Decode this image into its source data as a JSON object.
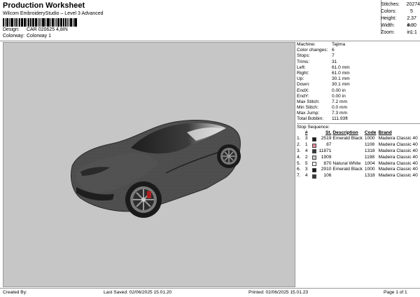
{
  "header": {
    "title": "Production Worksheet",
    "subtitle": "Wilcom EmbroideryStudio – Level 3 Advanced",
    "design_label": "Design:",
    "design_value": "CAR 020625 4,8IN",
    "colorway_label": "Colorway:",
    "colorway_value": "Colorway 1"
  },
  "summary": [
    {
      "k": "Stitches:",
      "v": "20274"
    },
    {
      "k": "Colors:",
      "v": "5"
    },
    {
      "k": "Height:",
      "v": "2.37 in"
    },
    {
      "k": "Width:",
      "v": "4.80 in"
    },
    {
      "k": "Zoom:",
      "v": "1:1"
    }
  ],
  "machine_info": [
    {
      "k": "Machine:",
      "v": "Tajima"
    },
    {
      "k": "Color changes:",
      "v": "6"
    },
    {
      "k": "Stops:",
      "v": "7"
    },
    {
      "k": "Trims:",
      "v": "31"
    },
    {
      "k": "Left:",
      "v": "61.0 mm"
    },
    {
      "k": "Right:",
      "v": "61.0 mm"
    },
    {
      "k": "Up:",
      "v": "30.1 mm"
    },
    {
      "k": "Down:",
      "v": "30.1 mm"
    },
    {
      "k": "EndX:",
      "v": "0.00 in"
    },
    {
      "k": "EndY:",
      "v": "0.00 in"
    },
    {
      "k": "Max Stitch:",
      "v": "7.2 mm"
    },
    {
      "k": "Min Stitch:",
      "v": "0.0 mm"
    },
    {
      "k": "Max Jump:",
      "v": "7.3 mm"
    },
    {
      "k": "Total Bobbin:",
      "v": "111.93ft"
    }
  ],
  "stop_sequence": {
    "title": "Stop Sequence:",
    "headers": {
      "num": "#",
      "st": "St.",
      "desc": "Description",
      "code": "Code",
      "brand": "Brand"
    },
    "rows": [
      {
        "stop": "1.",
        "n": "3",
        "color": "#1a1a1a",
        "st": "2519",
        "desc": "Emerald Black",
        "code": "1000",
        "brand": "Madeira Classic 40"
      },
      {
        "stop": "2.",
        "n": "1",
        "color": "#e58aa0",
        "st": "87",
        "desc": "",
        "code": "1108",
        "brand": "Madeira Classic 40"
      },
      {
        "stop": "3.",
        "n": "4",
        "color": "#3a3a3a",
        "st": "11871",
        "desc": "",
        "code": "1318",
        "brand": "Madeira Classic 40"
      },
      {
        "stop": "4.",
        "n": "2",
        "color": "#c8c8c8",
        "st": "1909",
        "desc": "",
        "code": "1198",
        "brand": "Madeira Classic 40"
      },
      {
        "stop": "5.",
        "n": "5",
        "color": "#ffffff",
        "st": "870",
        "desc": "Natural White",
        "code": "1004",
        "brand": "Madeira Classic 40"
      },
      {
        "stop": "6.",
        "n": "3",
        "color": "#1a1a1a",
        "st": "2910",
        "desc": "Emerald Black",
        "code": "1000",
        "brand": "Madeira Classic 40"
      },
      {
        "stop": "7.",
        "n": "4",
        "color": "#3a3a3a",
        "st": "106",
        "desc": "",
        "code": "1318",
        "brand": "Madeira Classic 40"
      }
    ]
  },
  "footer": {
    "created_by": "Created By:",
    "last_saved": "Last Saved: 02/06/2025 15.01.20",
    "printed": "Printed: 02/06/2025 15.01.23",
    "page": "Page 1 of 1"
  }
}
